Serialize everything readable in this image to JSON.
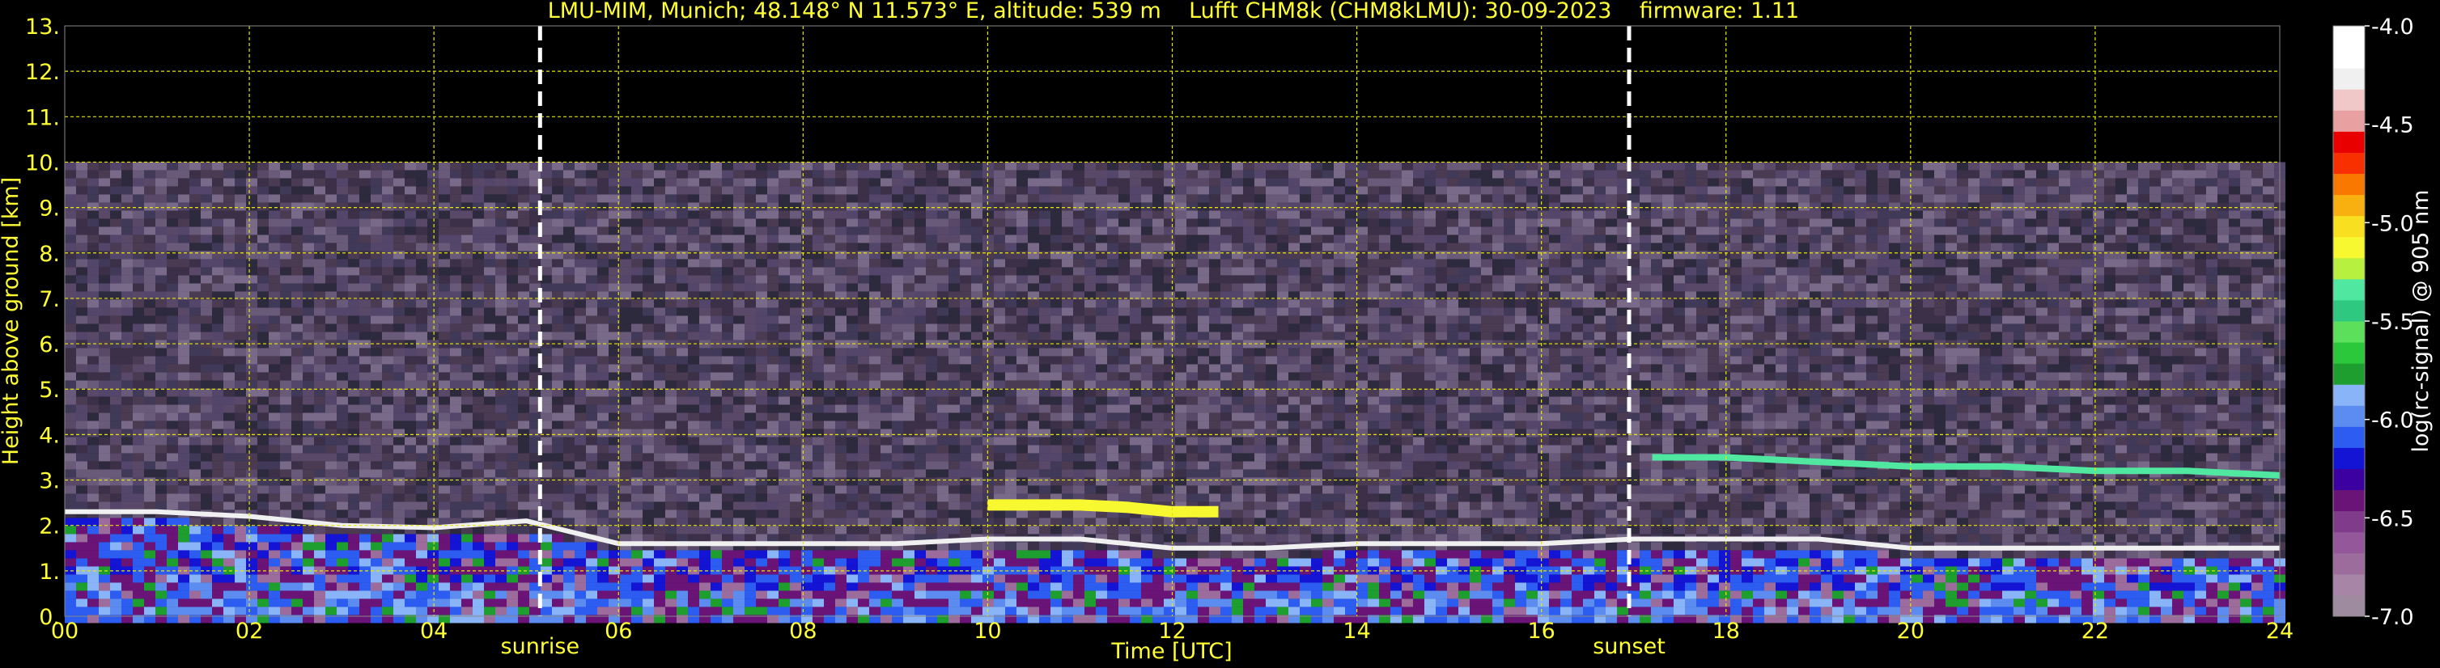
{
  "chart_data": {
    "type": "heatmap",
    "title": "LMU-MIM, Munich; 48.148° N 11.573° E, altitude: 539 m    Lufft CHM8k (CHM8kLMU): 30-09-2023    firmware: 1.11",
    "xlabel": "Time [UTC]",
    "ylabel": "Height above ground [km]",
    "xlim": [
      0,
      24
    ],
    "ylim": [
      0,
      13
    ],
    "x_ticks": [
      "00",
      "02",
      "04",
      "06",
      "08",
      "10",
      "12",
      "14",
      "16",
      "18",
      "20",
      "22",
      "24"
    ],
    "y_ticks": [
      "0.",
      "1.",
      "2.",
      "3.",
      "4.",
      "5.",
      "6.",
      "7.",
      "8.",
      "9.",
      "10.",
      "11.",
      "12.",
      "13."
    ],
    "grid": true,
    "markers": [
      {
        "label": "sunrise",
        "time": 5.15
      },
      {
        "label": "sunset",
        "time": 16.95
      }
    ],
    "data_top_km": 10.0,
    "colorbar": {
      "label": "log(rc-signal) @ 905 nm",
      "ticks": [
        "-4.0",
        "-4.5",
        "-5.0",
        "-5.5",
        "-6.0",
        "-6.5",
        "-7.0"
      ],
      "range": [
        -7.0,
        -4.0
      ],
      "colors": [
        "#9e8ba0",
        "#a785a6",
        "#9c6c9c",
        "#93579a",
        "#803c8a",
        "#6a1478",
        "#3c00a0",
        "#1414d4",
        "#2c5cf0",
        "#5c8cf0",
        "#8ab4f8",
        "#1e9e2e",
        "#2cc83c",
        "#5ce05c",
        "#2ec880",
        "#50e8a0",
        "#b8f040",
        "#f8f830",
        "#f8e020",
        "#f8b010",
        "#f87800",
        "#f83000",
        "#e80000",
        "#e8a0a0",
        "#f0c8c8",
        "#f0f0f0",
        "#ffffff",
        "#ffffff"
      ]
    },
    "layers": [
      {
        "name": "boundary_layer_top_km",
        "times": [
          0,
          1,
          2,
          3,
          4,
          5,
          6,
          7,
          8,
          9,
          10,
          11,
          12,
          13,
          14,
          15,
          16,
          17,
          18,
          19,
          20,
          21,
          22,
          23,
          24
        ],
        "heights": [
          2.3,
          2.3,
          2.2,
          2.0,
          1.95,
          2.1,
          1.6,
          1.6,
          1.6,
          1.6,
          1.7,
          1.7,
          1.5,
          1.5,
          1.6,
          1.6,
          1.6,
          1.7,
          1.7,
          1.7,
          1.5,
          1.5,
          1.5,
          1.5,
          1.5
        ]
      },
      {
        "name": "elevated_aerosol_layer_km",
        "times": [
          17.2,
          18,
          19,
          20,
          21,
          22,
          23,
          24
        ],
        "heights": [
          3.5,
          3.5,
          3.4,
          3.3,
          3.3,
          3.2,
          3.2,
          3.1
        ]
      },
      {
        "name": "mid_level_layer_km",
        "times": [
          10,
          10.5,
          11,
          11.5,
          12,
          12.5
        ],
        "heights": [
          2.45,
          2.45,
          2.45,
          2.4,
          2.3,
          2.3
        ]
      }
    ]
  }
}
